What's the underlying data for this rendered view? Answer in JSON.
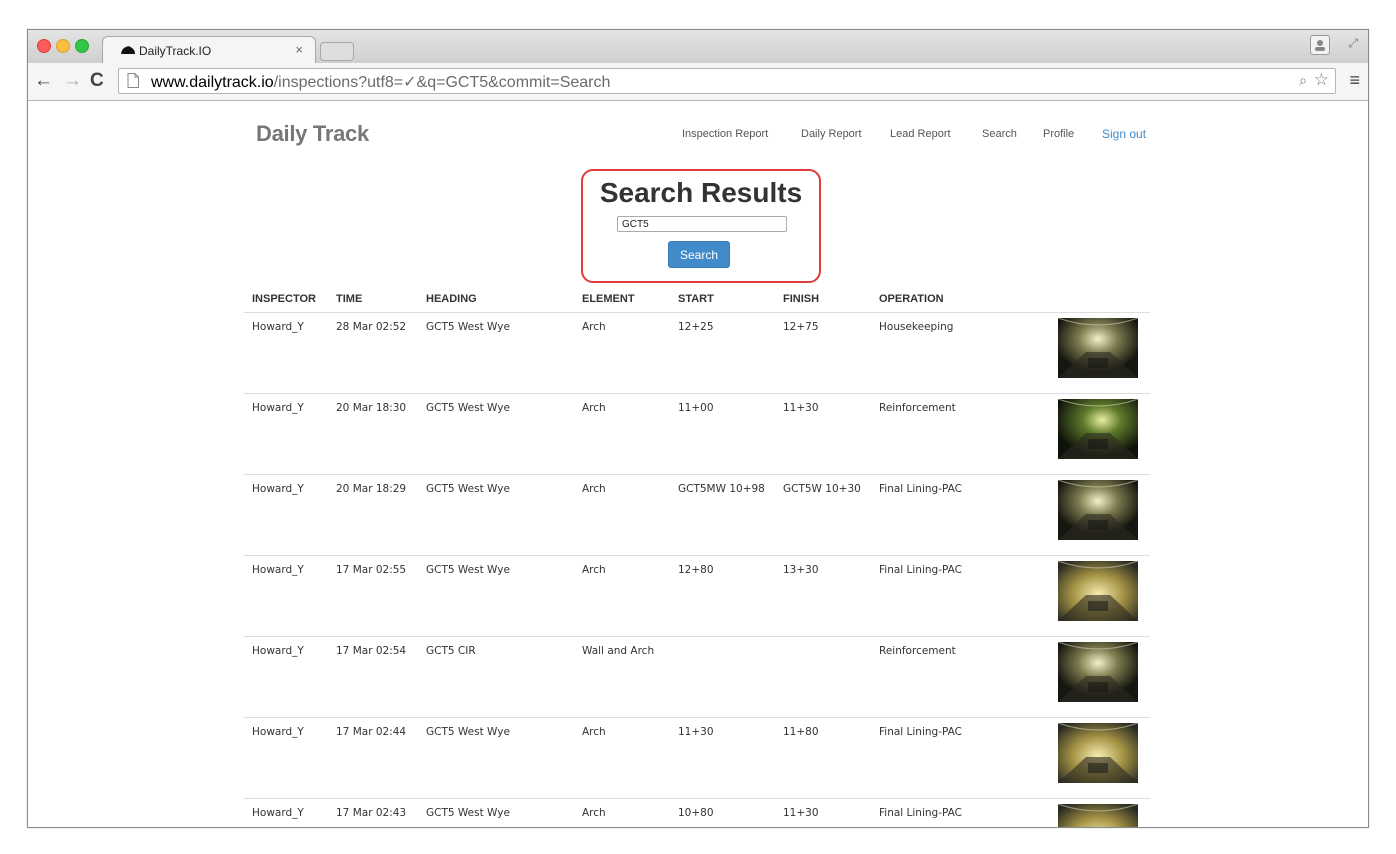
{
  "browser": {
    "tab_title": "DailyTrack.IO",
    "tab_close": "×",
    "url_host": "www.dailytrack.io",
    "url_path": "/inspections?utf8=✓&q=GCT5&commit=Search"
  },
  "header": {
    "brand": "Daily Track",
    "nav": [
      {
        "label": "Inspection Report"
      },
      {
        "label": "Daily Report"
      },
      {
        "label": "Lead Report"
      },
      {
        "label": "Search"
      },
      {
        "label": "Profile"
      },
      {
        "label": "Sign out"
      }
    ]
  },
  "search": {
    "title": "Search Results",
    "query": "GCT5",
    "button_label": "Search"
  },
  "table": {
    "columns": [
      "INSPECTOR",
      "TIME",
      "HEADING",
      "ELEMENT",
      "START",
      "FINISH",
      "OPERATION",
      ""
    ],
    "rows": [
      {
        "inspector": "Howard_Y",
        "time": "28 Mar 02:52",
        "heading": "GCT5 West Wye",
        "element": "Arch",
        "start": "12+25",
        "finish": "12+75",
        "operation": "Housekeeping"
      },
      {
        "inspector": "Howard_Y",
        "time": "20 Mar 18:30",
        "heading": "GCT5 West Wye",
        "element": "Arch",
        "start": "11+00",
        "finish": "11+30",
        "operation": "Reinforcement"
      },
      {
        "inspector": "Howard_Y",
        "time": "20 Mar 18:29",
        "heading": "GCT5 West Wye",
        "element": "Arch",
        "start": "GCT5MW 10+98",
        "finish": "GCT5W 10+30",
        "operation": "Final Lining-PAC"
      },
      {
        "inspector": "Howard_Y",
        "time": "17 Mar 02:55",
        "heading": "GCT5 West Wye",
        "element": "Arch",
        "start": "12+80",
        "finish": "13+30",
        "operation": "Final Lining-PAC"
      },
      {
        "inspector": "Howard_Y",
        "time": "17 Mar 02:54",
        "heading": "GCT5 CIR",
        "element": "Wall and Arch",
        "start": "",
        "finish": "",
        "operation": "Reinforcement"
      },
      {
        "inspector": "Howard_Y",
        "time": "17 Mar 02:44",
        "heading": "GCT5 West Wye",
        "element": "Arch",
        "start": "11+30",
        "finish": "11+80",
        "operation": "Final Lining-PAC"
      },
      {
        "inspector": "Howard_Y",
        "time": "17 Mar 02:43",
        "heading": "GCT5 West Wye",
        "element": "Arch",
        "start": "10+80",
        "finish": "11+30",
        "operation": "Final Lining-PAC"
      }
    ]
  },
  "colors": {
    "accent": "#428bca",
    "highlight": "#e23b3b"
  }
}
